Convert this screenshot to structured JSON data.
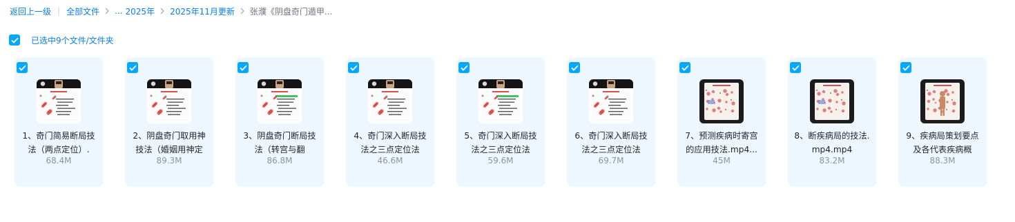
{
  "breadcrumb": {
    "back": "返回上一级",
    "all_files": "全部文件",
    "ellipsis": "...",
    "crumb_year": "2025年",
    "crumb_month": "2025年11月更新",
    "current": "张濮《阴盘奇门遁甲..."
  },
  "selection": {
    "label": "已选中9个文件/文件夹",
    "checked": true
  },
  "colors": {
    "accent": "#06a7ff",
    "link": "#0a7ee8",
    "card_bg": "#eef7ff"
  },
  "files": [
    {
      "name": "1、奇门简易断局技法（两点定位）.",
      "size": "68.4M",
      "thumb_style": "light"
    },
    {
      "name": "2、阴盘奇门取用神技法（婚姻用神定",
      "size": "89.3M",
      "thumb_style": "light"
    },
    {
      "name": "3、阴盘奇门断局技法（转宫与翻",
      "size": "86.8M",
      "thumb_style": "green"
    },
    {
      "name": "4、奇门深入断局技法之三点定位法",
      "size": "46.6M",
      "thumb_style": "light"
    },
    {
      "name": "5、奇门深入断局技法之三点定位法",
      "size": "59.6M",
      "thumb_style": "green"
    },
    {
      "name": "6、奇门深入断局技法之三点定位法",
      "size": "69.7M",
      "thumb_style": "light"
    },
    {
      "name": "7、预测疾病时寄宫的应用技法.mp4...",
      "size": "45M",
      "thumb_style": "dark"
    },
    {
      "name": "8、断疾病局的技法.mp4.mp4",
      "size": "83.2M",
      "thumb_style": "dark"
    },
    {
      "name": "9、疾病局策划要点及各代表疾病概",
      "size": "88.3M",
      "thumb_style": "dark-figure"
    }
  ]
}
